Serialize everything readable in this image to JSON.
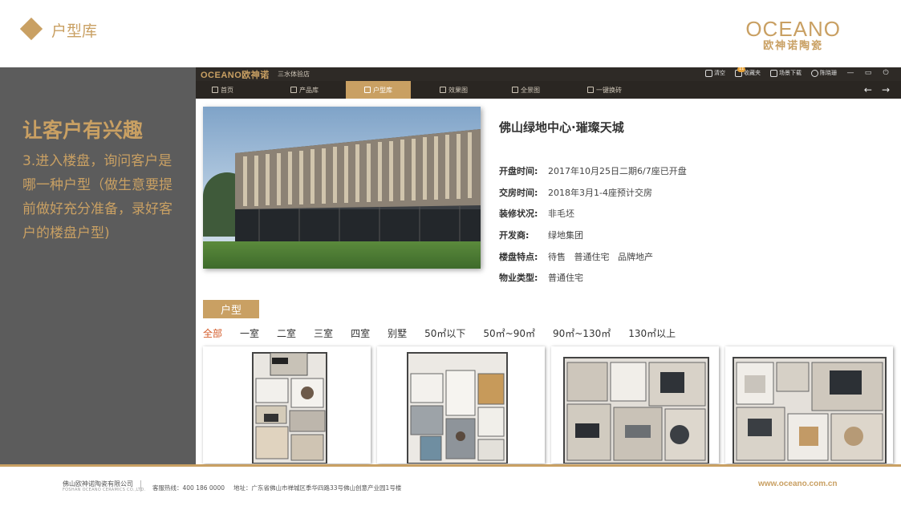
{
  "slide": {
    "title": "户型库",
    "brand_name": "OCEANO",
    "brand_cn": "欧神诺陶瓷"
  },
  "left_panel": {
    "heading": "让客户有兴趣",
    "body": "3.进入楼盘，询问客户是哪一种户型（做生意要提前做好充分准备，录好客户的楼盘户型)"
  },
  "app": {
    "logo": "OCEANO欧神诺",
    "store_name": "三水体验店",
    "top_actions": [
      {
        "label": "清空",
        "icon": "clear-icon"
      },
      {
        "label": "收藏夹",
        "icon": "favorites-icon",
        "badge": "11"
      },
      {
        "label": "场景下载",
        "icon": "download-icon"
      },
      {
        "label": "陈晓珊",
        "icon": "user-icon"
      }
    ],
    "window_controls": [
      "—",
      "▭",
      "⏻"
    ],
    "nav_tabs": [
      {
        "label": "首页",
        "icon": "home-icon"
      },
      {
        "label": "产品库",
        "icon": "grid-icon"
      },
      {
        "label": "户型库",
        "icon": "floorplan-icon",
        "active": true
      },
      {
        "label": "效果图",
        "icon": "image-icon"
      },
      {
        "label": "全景图",
        "icon": "panorama-icon"
      },
      {
        "label": "一键换砖",
        "icon": "swap-icon"
      }
    ],
    "nav_arrows": [
      "←",
      "→"
    ]
  },
  "property": {
    "name": "佛山绿地中心·璀璨天城",
    "info": [
      {
        "label": "开盘时间:",
        "value": "2017年10月25日二期6/7座已开盘"
      },
      {
        "label": "交房时间:",
        "value": "2018年3月1-4座预计交房"
      },
      {
        "label": "装修状况:",
        "value": "非毛坯"
      },
      {
        "label": "开发商:",
        "value": "绿地集团"
      },
      {
        "label": "楼盘特点:",
        "value": "待售   普通住宅   品牌地产"
      },
      {
        "label": "物业类型:",
        "value": "普通住宅"
      }
    ]
  },
  "unit_types": {
    "section_label": "户型",
    "filters": [
      "全部",
      "一室",
      "二室",
      "三室",
      "四室",
      "别墅",
      "50㎡以下",
      "50㎡~90㎡",
      "90㎡~130㎡",
      "130㎡以上"
    ],
    "active_filter": "全部",
    "plans_count_visible": 4
  },
  "footer": {
    "company": "佛山欧神诺陶瓷有限公司",
    "company_en": "FOSHAN OCEANO CERAMICS CO.,LTD.",
    "hotline": "客服热线：400 186 0000",
    "address": "地址：广东省佛山市禅城区季华四路33号佛山创意产业园1号楼",
    "url": "www.oceano.com.cn"
  },
  "colors": {
    "gold": "#c9a063",
    "dark_panel": "#5c5c5c",
    "app_bar": "#2e2a26",
    "active_filter": "#d35a28"
  }
}
